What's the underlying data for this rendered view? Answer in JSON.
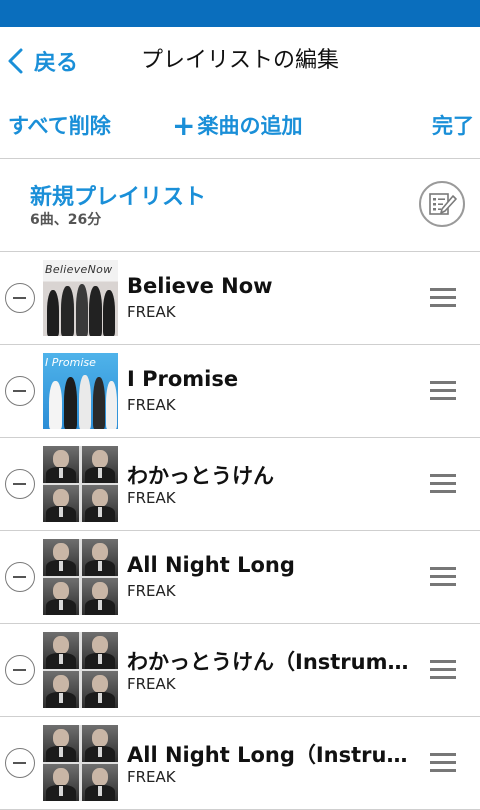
{
  "header": {
    "back_label": "戻る",
    "title": "プレイリストの編集"
  },
  "toolbar": {
    "delete_all": "すべて削除",
    "add_plus": "+",
    "add_label": "楽曲の追加",
    "done": "完了"
  },
  "playlist": {
    "name": "新規プレイリスト",
    "info": "6曲、26分"
  },
  "colors": {
    "statusbar": "#0a6ebd",
    "accent": "#1a8fd8",
    "divider": "#cfcfcf"
  },
  "tracks": [
    {
      "title": "Believe Now",
      "artist": "FREAK",
      "cover_text": "BelieveNow"
    },
    {
      "title": "I Promise",
      "artist": "FREAK",
      "cover_text": "I Promise"
    },
    {
      "title": "わかっとうけん",
      "artist": "FREAK"
    },
    {
      "title": "All Night Long",
      "artist": "FREAK"
    },
    {
      "title": "わかっとうけん（Instrume…",
      "artist": "FREAK"
    },
    {
      "title": "All Night Long（Instrument…",
      "artist": "FREAK"
    }
  ]
}
